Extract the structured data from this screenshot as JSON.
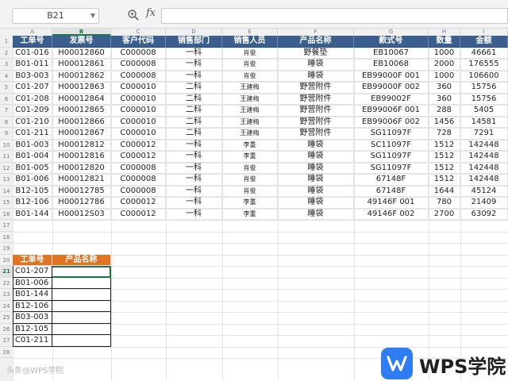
{
  "formula_bar": {
    "name_box": "B21",
    "zoom_icon": "zoom-icon",
    "fx_label": "fx",
    "formula_value": ""
  },
  "columns": [
    "A",
    "B",
    "C",
    "D",
    "E",
    "F",
    "G",
    "H",
    "I"
  ],
  "selected_column": "B",
  "selected_row": "21",
  "rows": [
    "1",
    "2",
    "3",
    "4",
    "5",
    "6",
    "7",
    "8",
    "9",
    "10",
    "11",
    "12",
    "13",
    "14",
    "15",
    "16",
    "17",
    "18",
    "19",
    "20",
    "21",
    "22",
    "23",
    "24",
    "25",
    "26",
    "27",
    "28"
  ],
  "table": {
    "headers": [
      "工单号",
      "发票号",
      "客户代码",
      "销售部门",
      "销售人员",
      "产品名称",
      "款式号",
      "数量",
      "金额"
    ],
    "rows": [
      [
        "C01-016",
        "H00012860",
        "C000008",
        "一科",
        "肖俊",
        "野餐垫",
        "EB10067",
        "1000",
        "46661"
      ],
      [
        "B01-011",
        "H00012861",
        "C000008",
        "一科",
        "肖俊",
        "睡袋",
        "EB10068",
        "2000",
        "176555"
      ],
      [
        "B03-003",
        "H00012862",
        "C000008",
        "一科",
        "肖俊",
        "睡袋",
        "EB99000F 001",
        "1000",
        "106600"
      ],
      [
        "C01-207",
        "H00012863",
        "C000010",
        "二科",
        "王建梅",
        "野营附件",
        "EB99000F 002",
        "360",
        "15756"
      ],
      [
        "C01-208",
        "H00012864",
        "C000010",
        "二科",
        "王建梅",
        "野营附件",
        "EB99002F",
        "360",
        "15756"
      ],
      [
        "C01-209",
        "H00012865",
        "C000010",
        "二科",
        "王建梅",
        "野营附件",
        "EB99006F 001",
        "288",
        "5405"
      ],
      [
        "C01-210",
        "H00012866",
        "C000010",
        "二科",
        "王建梅",
        "野营附件",
        "EB99006F 002",
        "1456",
        "14581"
      ],
      [
        "C01-211",
        "H00012867",
        "C000010",
        "二科",
        "王建梅",
        "野营附件",
        "SG11097F",
        "728",
        "7291"
      ],
      [
        "B01-003",
        "H00012812",
        "C000012",
        "一科",
        "李重",
        "睡袋",
        "SC11097F",
        "1512",
        "142448"
      ],
      [
        "B01-004",
        "H00012816",
        "C000012",
        "一科",
        "李重",
        "睡袋",
        "SG11097F",
        "1512",
        "142448"
      ],
      [
        "B01-005",
        "H00012820",
        "C000008",
        "一科",
        "肖俊",
        "睡袋",
        "SG11097F",
        "1512",
        "142448"
      ],
      [
        "B01-006",
        "H00012821",
        "C000008",
        "一科",
        "肖俊",
        "睡袋",
        "67148F",
        "1512",
        "142448"
      ],
      [
        "B12-105",
        "H00012785",
        "C000008",
        "一科",
        "肖俊",
        "睡袋",
        "67148F",
        "1644",
        "45124"
      ],
      [
        "B12-106",
        "H00012786",
        "C000012",
        "一科",
        "李重",
        "睡袋",
        "49146F 001",
        "780",
        "21409"
      ],
      [
        "B01-144",
        "H00012S03",
        "C000012",
        "一科",
        "李重",
        "睡袋",
        "49146F 002",
        "2700",
        "63092"
      ]
    ]
  },
  "lookup_table": {
    "headers": [
      "工单号",
      "产品名称"
    ],
    "ids": [
      "C01-207",
      "B01-006",
      "B01-144",
      "B12-106",
      "B03-003",
      "B12-105",
      "C01-211"
    ]
  },
  "watermark": "头条@WPS学院",
  "wps_logo_text": "WPS学院",
  "colors": {
    "header_blue": "#3a5f8f",
    "header_orange": "#e17325",
    "selection_green": "#217346",
    "wps_blue": "#2f7df3"
  }
}
